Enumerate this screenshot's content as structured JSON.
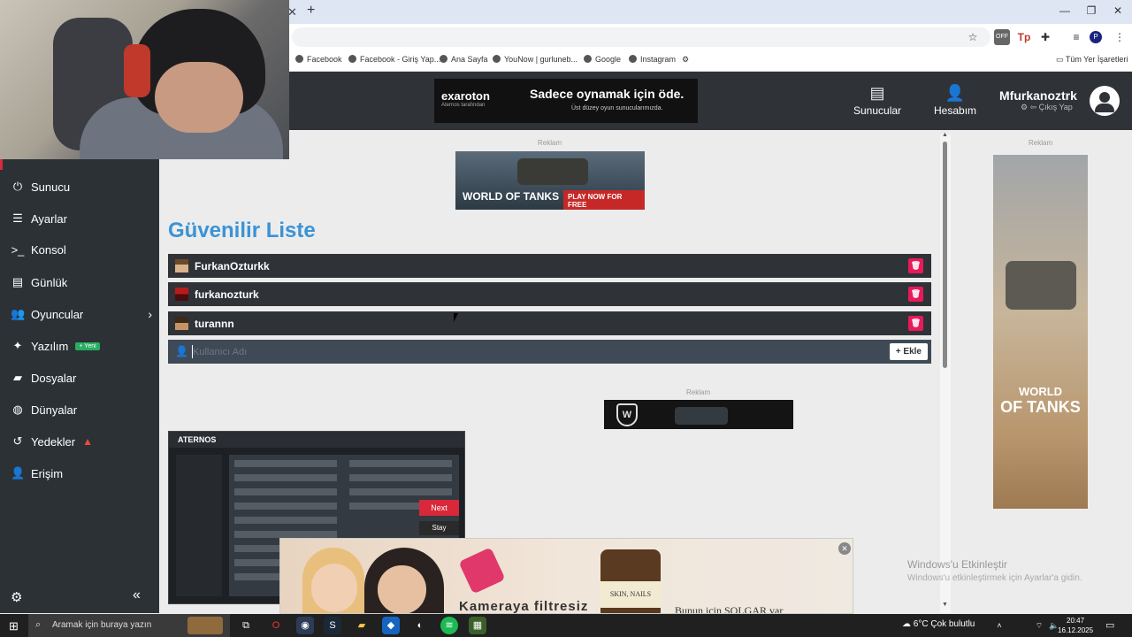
{
  "browser": {
    "bookmarks": [
      {
        "label": "Facebook"
      },
      {
        "label": "Facebook - Giriş Yap..."
      },
      {
        "label": "Ana Sayfa"
      },
      {
        "label": "YouNow | gurluneb..."
      },
      {
        "label": "Google"
      },
      {
        "label": "Instagram"
      }
    ],
    "all_bookmarks": "Tüm Yer İşaretleri"
  },
  "header": {
    "ad": {
      "brand": "exaroton",
      "brand_sub": "Aternos tarafından",
      "headline": "Sadece oynamak için öde.",
      "subline": "Üst düzey oyun sunucularımızda."
    },
    "servers_label": "Sunucular",
    "account_label": "Hesabım",
    "username": "Mfurkanoztrk",
    "logout_label": "Çıkış Yap"
  },
  "sidebar": {
    "items": [
      {
        "label": "Sunucu",
        "icon": "power-icon"
      },
      {
        "label": "Ayarlar",
        "icon": "list-icon"
      },
      {
        "label": "Konsol",
        "icon": "terminal-icon"
      },
      {
        "label": "Günlük",
        "icon": "file-icon"
      },
      {
        "label": "Oyuncular",
        "icon": "users-icon"
      },
      {
        "label": "Yazılım",
        "icon": "sparkle-icon",
        "badge": "+ Yeni"
      },
      {
        "label": "Dosyalar",
        "icon": "folder-icon"
      },
      {
        "label": "Dünyalar",
        "icon": "globe-icon"
      },
      {
        "label": "Yedekler",
        "icon": "history-icon"
      },
      {
        "label": "Erişim",
        "icon": "user-lock-icon"
      }
    ]
  },
  "main": {
    "ad_label": "Reklam",
    "wot_play": "PLAY NOW FOR FREE",
    "wot_logo": "WORLD OF TANKS",
    "title": "Güvenilir Liste",
    "whitelist": [
      {
        "name": "FurkanOzturkk"
      },
      {
        "name": "furkanozturk"
      },
      {
        "name": "turannn"
      }
    ],
    "input_placeholder": "Kullanıcı Adı",
    "add_label": "Ekle",
    "video": {
      "logo": "ATERNOS",
      "next": "Next",
      "stay": "Stay"
    }
  },
  "right_ad": {
    "label": "Reklam",
    "logo_small": "WORLD",
    "logo_big": "OF TANKS"
  },
  "bottom_ad": {
    "text1": "Kameraya filtresiz",
    "jar": "SKIN, NAILS",
    "text2": "Bunun için SOLGAR var"
  },
  "windows": {
    "activate_title": "Windows'u Etkinleştir",
    "activate_sub": "Windows'u etkinleştirmek için Ayarlar'a gidin.",
    "search_placeholder": "Aramak için buraya yazın",
    "weather": "6°C  Çok bulutlu",
    "time": "20:47",
    "date": "16.12.2025"
  },
  "colors": {
    "accent": "#3b93d6",
    "sidebar": "#2c3136",
    "delete": "#e9195a"
  }
}
